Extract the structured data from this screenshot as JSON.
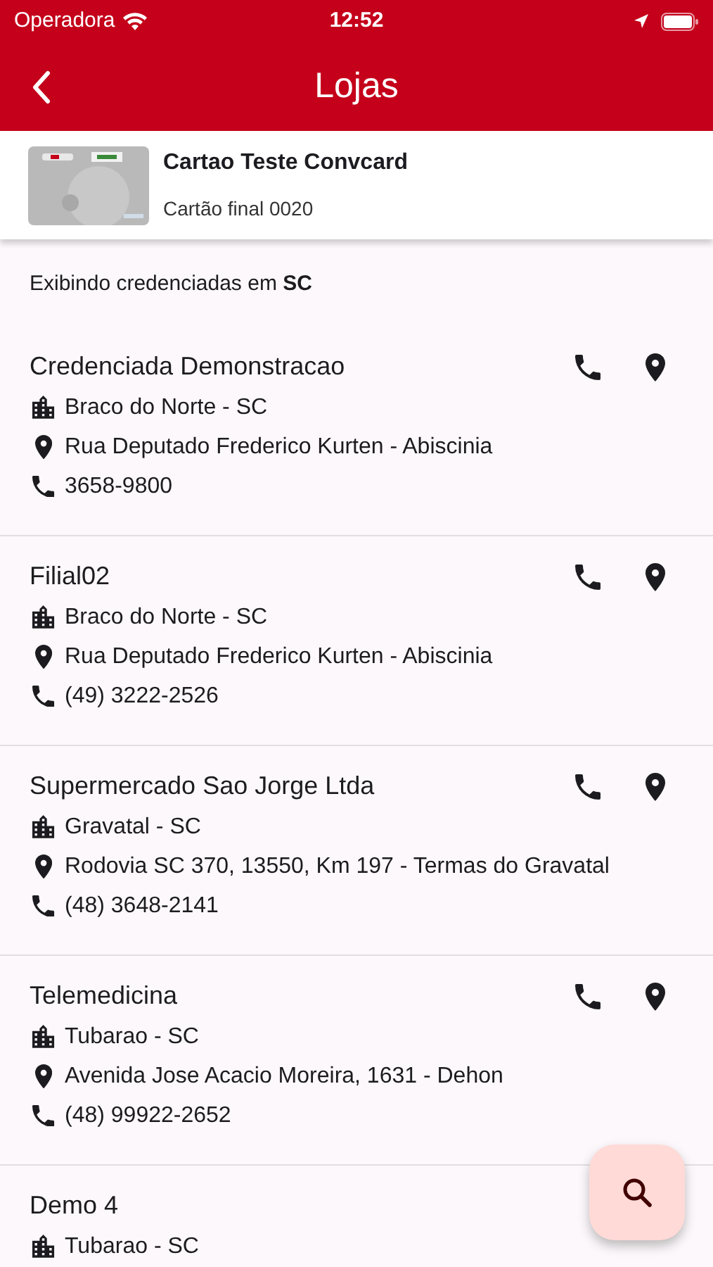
{
  "status_bar": {
    "carrier": "Operadora",
    "time": "12:52"
  },
  "header": {
    "title": "Lojas"
  },
  "card": {
    "name": "Cartao Teste Convcard",
    "subtitle": "Cartão final 0020"
  },
  "filter_text": "Exibindo credenciadas em **SC**",
  "stores": [
    {
      "name": "Credenciada Demonstracao",
      "city": "Braco do Norte - SC",
      "address": "Rua Deputado Frederico Kurten - Abiscinia",
      "phone": "3658-9800"
    },
    {
      "name": "Filial02",
      "city": "Braco do Norte - SC",
      "address": "Rua Deputado Frederico Kurten - Abiscinia",
      "phone": "(49) 3222-2526"
    },
    {
      "name": "Supermercado Sao Jorge Ltda",
      "city": "Gravatal - SC",
      "address": "Rodovia SC 370, 13550, Km 197 - Termas do Gravatal",
      "phone": "(48) 3648-2141"
    },
    {
      "name": "Telemedicina",
      "city": "Tubarao - SC",
      "address": "Avenida Jose Acacio Moreira, 1631 - Dehon",
      "phone": "(48) 99922-2652"
    },
    {
      "name": "Demo 4",
      "city": "Tubarao - SC"
    }
  ]
}
